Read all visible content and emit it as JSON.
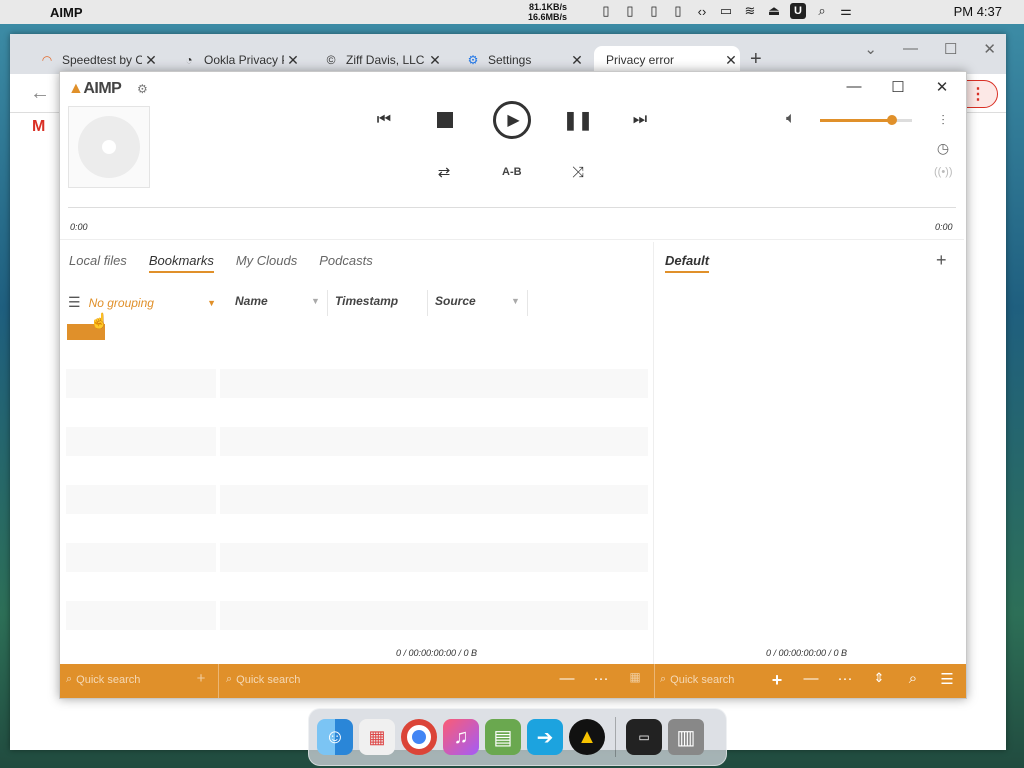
{
  "menubar": {
    "app_name": "AIMP",
    "net_up": "81.1KB/s",
    "net_down": "16.6MB/s",
    "clock": "PM 4:37"
  },
  "browser": {
    "tabs": [
      {
        "title": "Speedtest by O"
      },
      {
        "title": "Ookla Privacy P"
      },
      {
        "title": "Ziff Davis, LLC"
      },
      {
        "title": "Settings"
      },
      {
        "title": "Privacy error"
      }
    ]
  },
  "aimp": {
    "logo": "AIMP",
    "ab_label": "A-B",
    "time_left": "0:00",
    "time_right": "0:00",
    "volume_percent": 78,
    "tabs": [
      "Local files",
      "Bookmarks",
      "My Clouds",
      "Podcasts"
    ],
    "active_tab": "Bookmarks",
    "playlist_name": "Default",
    "grouping_label": "No grouping",
    "columns": [
      "Name",
      "Timestamp",
      "Source"
    ],
    "left_count": "0 / 00:00:00:00 / 0 B",
    "right_count": "0 / 00:00:00:00 / 0 B",
    "quick_search_placeholder": "Quick search"
  },
  "colors": {
    "accent": "#e0902a"
  }
}
